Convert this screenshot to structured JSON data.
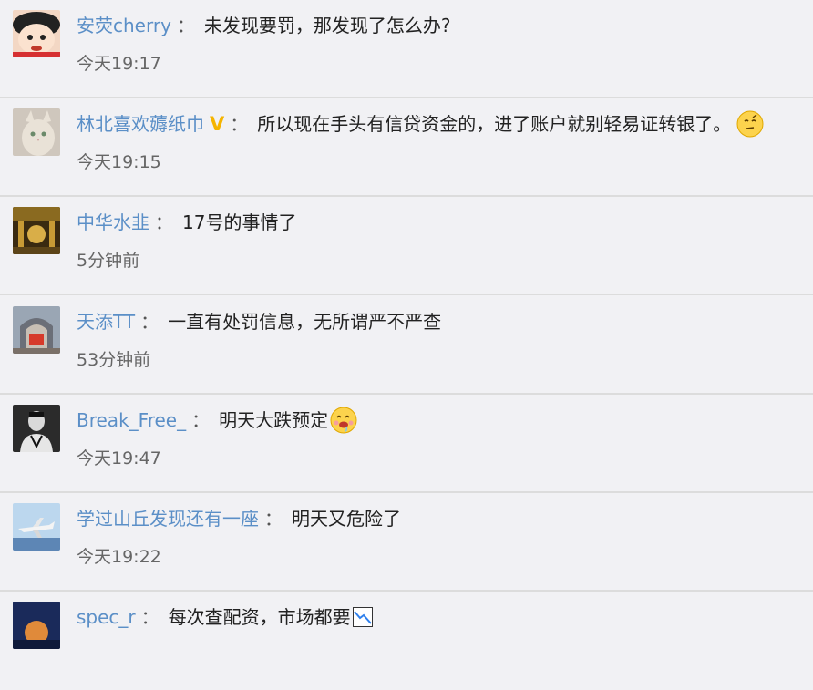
{
  "comments": [
    {
      "user": "安荧cherry",
      "sep": "：",
      "text": "未发现要罚，那发现了怎么办?",
      "time": "今天19:17",
      "avatar": "cartoon-boy-avatar"
    },
    {
      "user": "林北喜欢薅纸巾",
      "vip": "V",
      "sep": "：",
      "text": "所以现在手头有信贷资金的，进了账户就别轻易证转银了。",
      "time": "今天19:15",
      "avatar": "cat-avatar",
      "emoji": "thinking-face-icon"
    },
    {
      "user": "中华水韭",
      "sep": "：",
      "text": "17号的事情了",
      "time": "5分钟前",
      "avatar": "golden-hall-avatar"
    },
    {
      "user": "天添TT",
      "sep": "：",
      "text": "一直有处罚信息，无所谓严不严查",
      "time": "53分钟前",
      "avatar": "red-gate-avatar"
    },
    {
      "user": "Break_Free_",
      "sep": "：",
      "text": "明天大跌预定",
      "time": "今天19:47",
      "avatar": "person-portrait-avatar",
      "emoji": "drooling-face-icon"
    },
    {
      "user": "学过山丘发现还有一座",
      "sep": "：",
      "text": "明天又危险了",
      "time": "今天19:22",
      "avatar": "airplane-avatar"
    },
    {
      "user": "spec_r",
      "sep": "：",
      "text": "每次查配资，市场都要",
      "time": "",
      "avatar": "moon-night-avatar",
      "emoji": "chart-decreasing-icon"
    }
  ],
  "colors": {
    "background": "#f1f1f4",
    "username": "#5b8fc7",
    "divider": "#dcdcdc",
    "vip": "#f5b400"
  }
}
